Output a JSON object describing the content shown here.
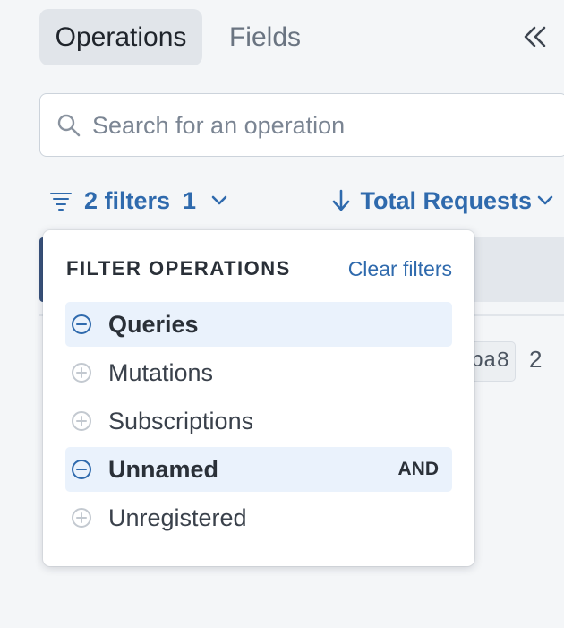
{
  "tabs": {
    "operations": "Operations",
    "fields": "Fields"
  },
  "search": {
    "placeholder": "Search for an operation",
    "value": ""
  },
  "filter_bar": {
    "filters_label": "2 filters",
    "filters_count": "1",
    "sort_label": "Total Requests"
  },
  "list": {
    "hash_fragment": "ba8",
    "count": "2"
  },
  "dropdown": {
    "title": "FILTER OPERATIONS",
    "clear_label": "Clear filters",
    "options": [
      {
        "label": "Queries",
        "selected": true
      },
      {
        "label": "Mutations",
        "selected": false
      },
      {
        "label": "Subscriptions",
        "selected": false
      },
      {
        "label": "Unnamed",
        "selected": true,
        "badge": "AND"
      },
      {
        "label": "Unregistered",
        "selected": false
      }
    ]
  },
  "icons": {
    "collapse": "double-chevron-left-icon",
    "search": "search-icon",
    "filter": "filter-lines-icon",
    "sort": "arrow-down-icon",
    "selected_option": "minus-circle-icon",
    "unselected_option": "plus-circle-icon"
  },
  "colors": {
    "accent": "#2f6aad",
    "selected_bg": "#eaf2fc",
    "active_tab_bg": "#e1e5ea"
  }
}
